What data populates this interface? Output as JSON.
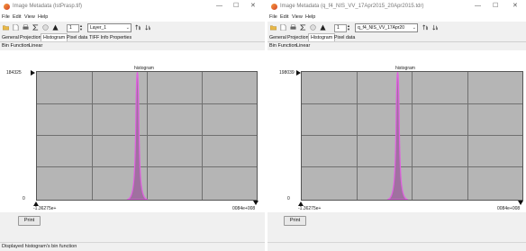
{
  "colors": {
    "plot_background": "#b5b5b5",
    "histogram_line": "#e060e0",
    "histogram_fill": "#a070a0",
    "grid": "#707070"
  },
  "windows": [
    {
      "title": "Image Metadata (lstPrasp.tif)",
      "window_buttons": [
        "—",
        "☐",
        "✕"
      ],
      "menu": [
        "File",
        "Edit",
        "View",
        "Help"
      ],
      "toolbar": {
        "icons": [
          "open-folder-icon",
          "new-document-icon",
          "print-icon",
          "sigma-icon",
          "zoom-icon",
          "warning-icon",
          "sort-ascending-icon",
          "sort-descending-icon"
        ],
        "band_value": "1",
        "layer_combo": "Layer_1"
      },
      "tabs": [
        "General",
        "Projection",
        "Histogram",
        "Pixel data",
        "TIFF Info",
        "Properties"
      ],
      "active_tab": "Histogram",
      "subbar": [
        "Bin Function",
        "Linear"
      ],
      "histogram": {
        "title": "histogram",
        "y_max_label": "184325",
        "y_min_label": "0",
        "x_min_label": "-1.36275e+",
        "x_max_label": "0084e+008"
      },
      "print_label": "Print",
      "status": "Displayed histogram's bin function"
    },
    {
      "title": "Image Metadata (q_f4_NIS_VV_17Apr2015_20Apr2015.tdr)",
      "window_buttons": [
        "—",
        "☐",
        "✕"
      ],
      "menu": [
        "File",
        "Edit",
        "View",
        "Help"
      ],
      "toolbar": {
        "icons": [
          "open-folder-icon",
          "new-document-icon",
          "print-icon",
          "sigma-icon",
          "zoom-icon",
          "warning-icon",
          "sort-ascending-icon",
          "sort-descending-icon"
        ],
        "band_value": "1",
        "layer_combo": "q_f4_NIS_VV_17Apr20"
      },
      "tabs": [
        "General",
        "Projection",
        "Histogram",
        "Pixel data"
      ],
      "active_tab": "Histogram",
      "subbar": [
        "Bin Function",
        "Linear"
      ],
      "histogram": {
        "title": "histogram",
        "y_max_label": "198039",
        "y_min_label": "0",
        "x_min_label": "-1.36275e+",
        "x_max_label": "0084e+008"
      },
      "print_label": "Print",
      "status": ""
    }
  ]
}
